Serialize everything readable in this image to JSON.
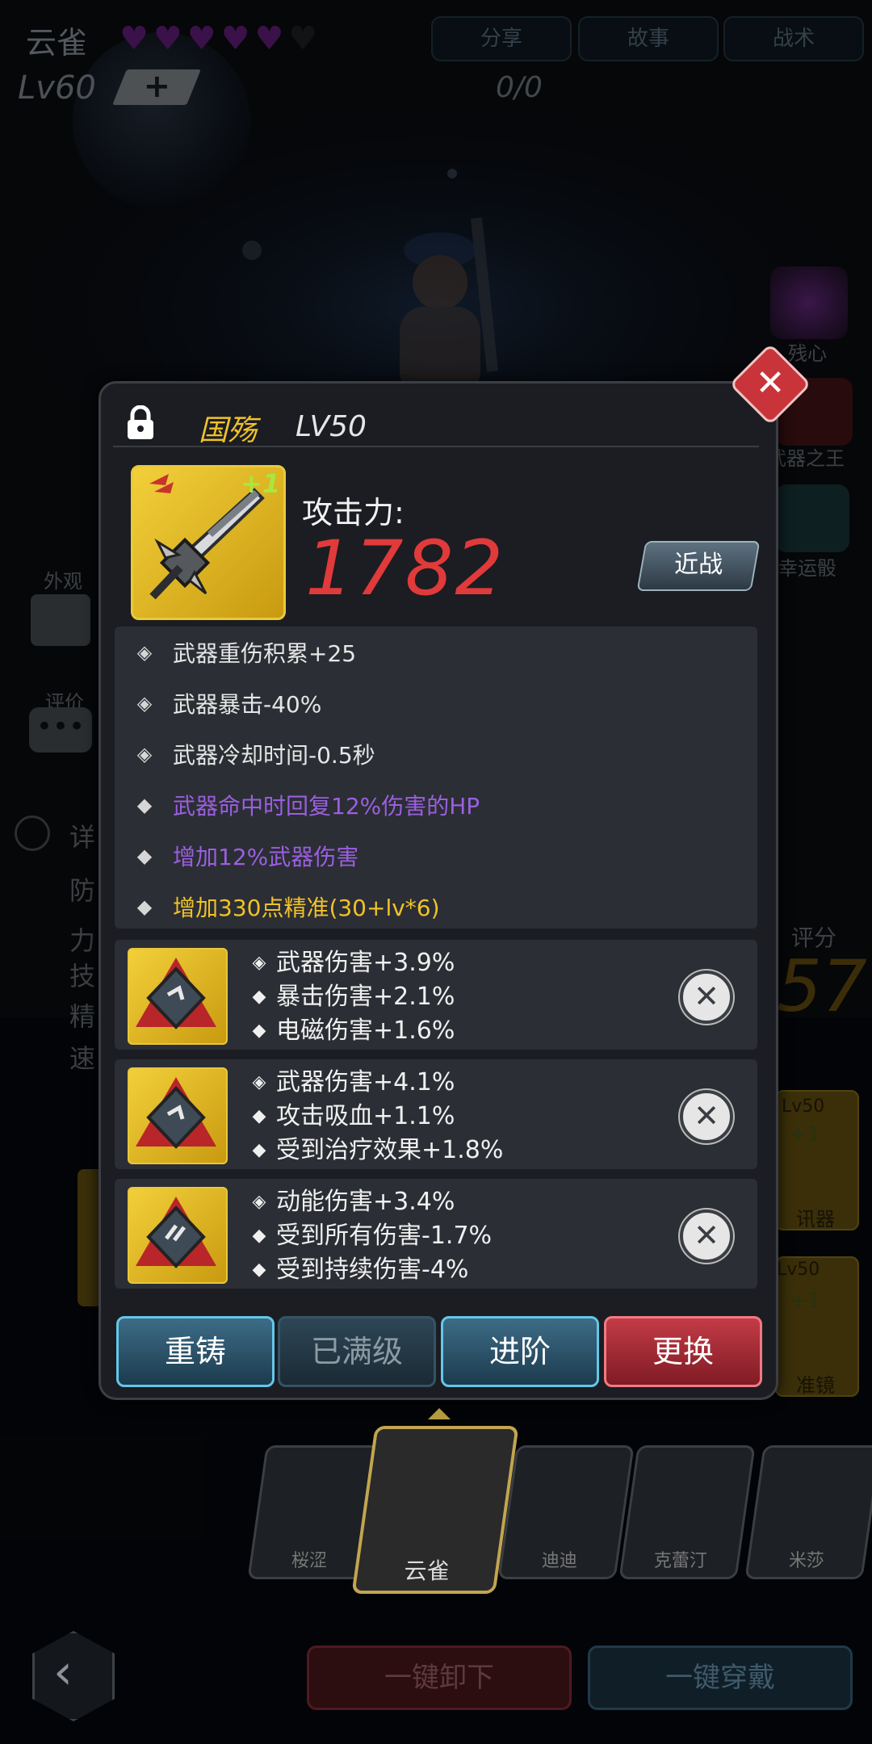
{
  "hero": {
    "name": "云雀",
    "level": "Lv60",
    "plus": "+",
    "counter": "0/0",
    "hearts_filled": 5,
    "hearts_total": 6
  },
  "top_buttons": [
    "分享",
    "故事",
    "战术"
  ],
  "right_side": [
    "残心",
    "武器之王",
    "幸运骰"
  ],
  "left_side": {
    "appearance": "外观",
    "review": "评价",
    "detail": "详",
    "stats": [
      "防",
      "力",
      "技",
      "精",
      "速"
    ]
  },
  "score": {
    "label": "评分",
    "value": "57"
  },
  "right_equip": [
    {
      "level": "Lv50",
      "plus": "+1",
      "name": "讯器"
    },
    {
      "level": "Lv50",
      "plus": "+1",
      "name": "准镜"
    }
  ],
  "panel": {
    "weapon_name": "国殇",
    "weapon_level": "LV50",
    "weapon_plus": "+1",
    "attack_label": "攻击力:",
    "attack_value": "1782",
    "type_label": "近战",
    "attributes": [
      {
        "text": "武器重伤积累+25",
        "color": "#e6e6e6",
        "icon": "rune-icon"
      },
      {
        "text": "武器暴击-40%",
        "color": "#e6e6e6",
        "icon": "rune-icon"
      },
      {
        "text": "武器冷却时间-0.5秒",
        "color": "#e6e6e6",
        "icon": "rune-icon"
      },
      {
        "text": "武器命中时回复12%伤害的HP",
        "color": "#9b5fe0",
        "icon": "diamond-icon"
      },
      {
        "text": "增加12%武器伤害",
        "color": "#9b5fe0",
        "icon": "diamond-icon"
      },
      {
        "text": "增加330点精准(30+lv*6)",
        "color": "#f0c22a",
        "icon": "diamond-icon"
      }
    ],
    "gems": [
      {
        "lines": [
          "武器伤害+3.9%",
          "暴击伤害+2.1%",
          "电磁伤害+1.6%"
        ]
      },
      {
        "lines": [
          "武器伤害+4.1%",
          "攻击吸血+1.1%",
          "受到治疗效果+1.8%"
        ]
      },
      {
        "lines": [
          "动能伤害+3.4%",
          "受到所有伤害-1.7%",
          "受到持续伤害-4%"
        ]
      }
    ],
    "buttons": {
      "reforge": "重铸",
      "maxed": "已满级",
      "advance": "进阶",
      "replace": "更换"
    }
  },
  "heroes": [
    {
      "name": "桜涩"
    },
    {
      "name": "云雀"
    },
    {
      "name": "迪迪"
    },
    {
      "name": "克蕾汀"
    },
    {
      "name": "米莎"
    }
  ],
  "bottom": {
    "unequip_all": "一键卸下",
    "equip_all": "一键穿戴"
  },
  "colors": {
    "attack": "#e03a3a",
    "gold": "#f0c22a",
    "purple": "#9b5fe0",
    "heart": "#6c1f86"
  }
}
